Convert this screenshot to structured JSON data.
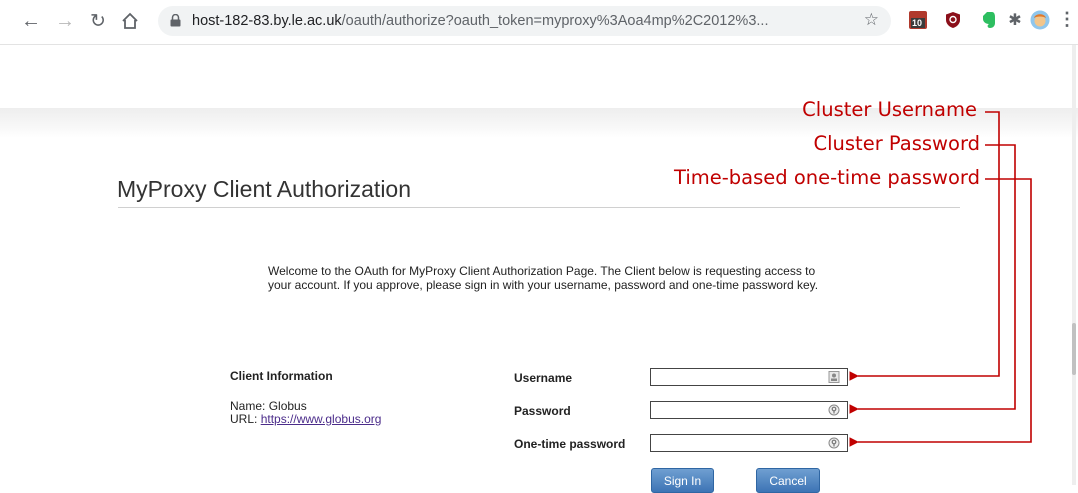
{
  "browser": {
    "url_host": "host-182-83.by.le.ac.uk",
    "url_rest": "/oauth/authorize?oauth_token=myproxy%3Aoa4mp%2C2012%3...",
    "calendar_badge": "10"
  },
  "page": {
    "title": "MyProxy Client Authorization",
    "welcome": "Welcome to the OAuth for MyProxy Client Authorization Page. The Client below is requesting access to your account. If you approve, please sign in with your username, password and one-time password key."
  },
  "client": {
    "heading": "Client Information",
    "name_label": "Name:",
    "name": "Globus",
    "url_label": "URL:",
    "url": "https://www.globus.org"
  },
  "form": {
    "username_label": "Username",
    "password_label": "Password",
    "otp_label": "One-time password",
    "username_value": "",
    "password_value": "",
    "otp_value": "",
    "signin_label": "Sign In",
    "cancel_label": "Cancel"
  },
  "annotations": {
    "username": "Cluster Username",
    "password": "Cluster Password",
    "otp": "Time-based one-time password",
    "color": "#c00000"
  }
}
